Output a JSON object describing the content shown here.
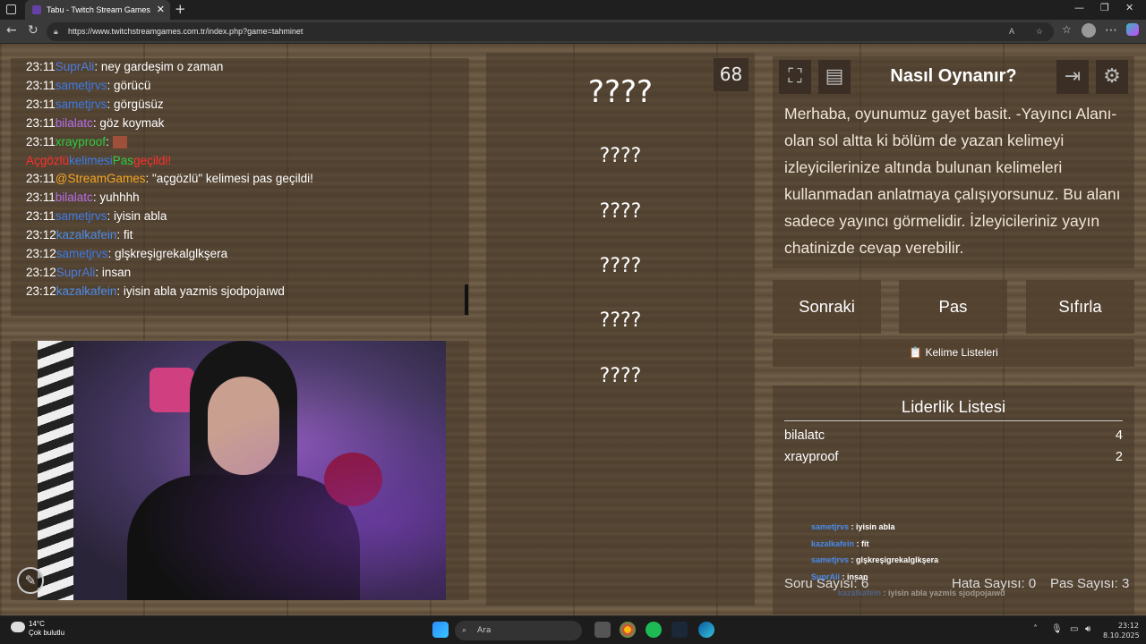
{
  "browser": {
    "tab_title": "Tabu - Twitch Stream Games",
    "url": "https://www.twitchstreamgames.com.tr/index.php?game=tahminet",
    "new_tab": "+",
    "tab_close": "✕"
  },
  "chat": [
    {
      "time": "23:11",
      "user": "SuprAli",
      "color": "sblue",
      "msg": ": ney gardeşim o zaman"
    },
    {
      "time": "23:11",
      "user": "sametjrvs",
      "color": "blue",
      "msg": ": görücü"
    },
    {
      "time": "23:11",
      "user": "sametjrvs",
      "color": "blue",
      "msg": ": görgüsüz"
    },
    {
      "time": "23:11",
      "user": "bilalatc",
      "color": "purple",
      "msg": ": göz koymak"
    },
    {
      "time": "23:11",
      "user": "xrayproof",
      "color": "green",
      "msg": ":"
    },
    {
      "time": "",
      "user": "",
      "color": "",
      "msg": ""
    },
    {
      "time": "23:11",
      "user": "@StreamGames",
      "color": "orange",
      "msg": ": \"açgözlü\" kelimesi pas geçildi!"
    },
    {
      "time": "23:11",
      "user": "bilalatc",
      "color": "purple",
      "msg": ": yuhhhh"
    },
    {
      "time": "23:11",
      "user": "sametjrvs",
      "color": "blue",
      "msg": ": iyisin abla"
    },
    {
      "time": "23:12",
      "user": "kazalkafein",
      "color": "kaz",
      "msg": ": fit"
    },
    {
      "time": "23:12",
      "user": "sametjrvs",
      "color": "blue",
      "msg": ": glşkreşigrekalglkşera"
    },
    {
      "time": "23:12",
      "user": "SuprAli",
      "color": "sblue",
      "msg": ": insan"
    },
    {
      "time": "23:12",
      "user": "kazalkafein",
      "color": "kaz",
      "msg": ": iyisin abla yazmis sjodpojaıwd"
    }
  ],
  "pass_notice": {
    "w1": "Açgözlü",
    "w2": "kelimesi",
    "w3": "Pas",
    "w4": "geçildi!"
  },
  "timer": "68",
  "words": [
    "????",
    "????",
    "????",
    "????",
    "????",
    "????"
  ],
  "howto": {
    "title": "Nasıl Oynanır?",
    "text": "Merhaba, oyunumuz gayet basit. -Yayıncı Alanı-olan sol altta ki bölüm de yazan kelimeyi izleyicilerinize altında bulunan kelimeleri kullanmadan anlatmaya çalışıyorsunuz. Bu alanı sadece yayıncı görmelidir. İzleyicileriniz yayın chatinizde cevap verebilir."
  },
  "buttons": {
    "next": "Sonraki",
    "pass": "Pas",
    "reset": "Sıfırla",
    "word_lists": "Kelime Listeleri",
    "word_lists_icon": "📋"
  },
  "leaderboard": {
    "title": "Liderlik Listesi",
    "rows": [
      {
        "name": "bilalatc",
        "score": "4"
      },
      {
        "name": "xrayproof",
        "score": "2"
      }
    ]
  },
  "stats": {
    "question": "Soru Sayısı: 6",
    "errors": "Hata Sayısı: 0",
    "passes": "Pas Sayısı: 3"
  },
  "overlay": [
    {
      "user": "sametjrvs",
      "msg": " : iyisin abla"
    },
    {
      "user": "kazalkafein",
      "msg": " : fit"
    },
    {
      "user": "sametjrvs",
      "msg": " : glşkreşigrekalglkşera"
    },
    {
      "user": "SuprAli",
      "msg": " : insan"
    },
    {
      "user": "kazalkafein",
      "msg": " : iyisin abla yazmis sjodpojaıwd"
    }
  ],
  "taskbar": {
    "temp": "14°C",
    "weather": "Çok bulutlu",
    "search": "Ara",
    "time": "23:12",
    "date": "8.10.2025"
  }
}
